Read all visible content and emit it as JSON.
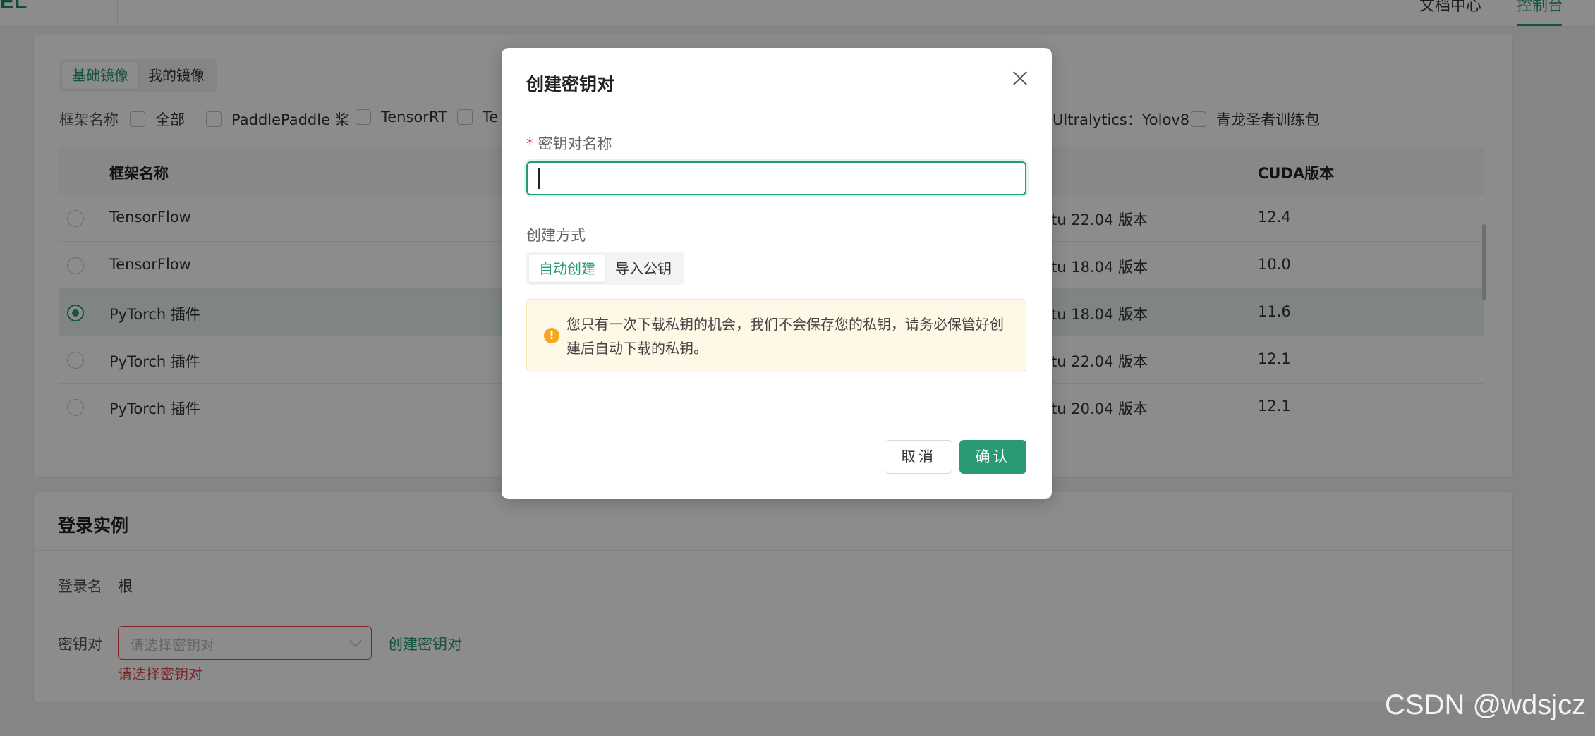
{
  "topbar": {
    "logo_text": "EL",
    "nav": [
      {
        "label": "文档中心"
      },
      {
        "label": "控制台"
      }
    ]
  },
  "image_tabs": [
    {
      "label": "基础镜像",
      "active": true
    },
    {
      "label": "我的镜像",
      "active": false
    }
  ],
  "framework_filter": {
    "label": "框架名称",
    "options": [
      {
        "label": "全部"
      },
      {
        "label": "PaddlePaddle 桨"
      },
      {
        "label": "TensorRT"
      },
      {
        "label": "Te"
      },
      {
        "label": "Ultralytics：Yolov8"
      },
      {
        "label": "青龙圣者训练包"
      }
    ]
  },
  "table": {
    "columns": [
      "框架名称",
      "CUDA版本"
    ],
    "rows": [
      {
        "name": "TensorFlow",
        "os": "tu 22.04 版本",
        "cuda": "12.4",
        "selected": false
      },
      {
        "name": "TensorFlow",
        "os": "tu 18.04 版本",
        "cuda": "10.0",
        "selected": false
      },
      {
        "name": "PyTorch 插件",
        "os": "tu 18.04 版本",
        "cuda": "11.6",
        "selected": true
      },
      {
        "name": "PyTorch 插件",
        "os": "tu 22.04 版本",
        "cuda": "12.1",
        "selected": false
      },
      {
        "name": "PyTorch 插件",
        "os": "tu 20.04 版本",
        "cuda": "12.1",
        "selected": false
      }
    ]
  },
  "login_section": {
    "title": "登录实例",
    "login_name_label": "登录名",
    "login_name_value": "根",
    "keypair_label": "密钥对",
    "keypair_placeholder": "请选择密钥对",
    "create_link": "创建密钥对",
    "error_text": "请选择密钥对"
  },
  "modal": {
    "title": "创建密钥对",
    "name_label": "密钥对名称",
    "name_value": "",
    "method_label": "创建方式",
    "methods": [
      {
        "label": "自动创建",
        "active": true
      },
      {
        "label": "导入公钥",
        "active": false
      }
    ],
    "alert_text": "您只有一次下载私钥的机会，我们不会保存您的私钥，请务必保管好创建后自动下载的私钥。",
    "cancel_label": "取消",
    "confirm_label": "确认"
  },
  "watermark": "CSDN @wdsjcz",
  "colors": {
    "accent": "#2a9a74",
    "error": "#e5484d",
    "warning": "#f5a623"
  }
}
